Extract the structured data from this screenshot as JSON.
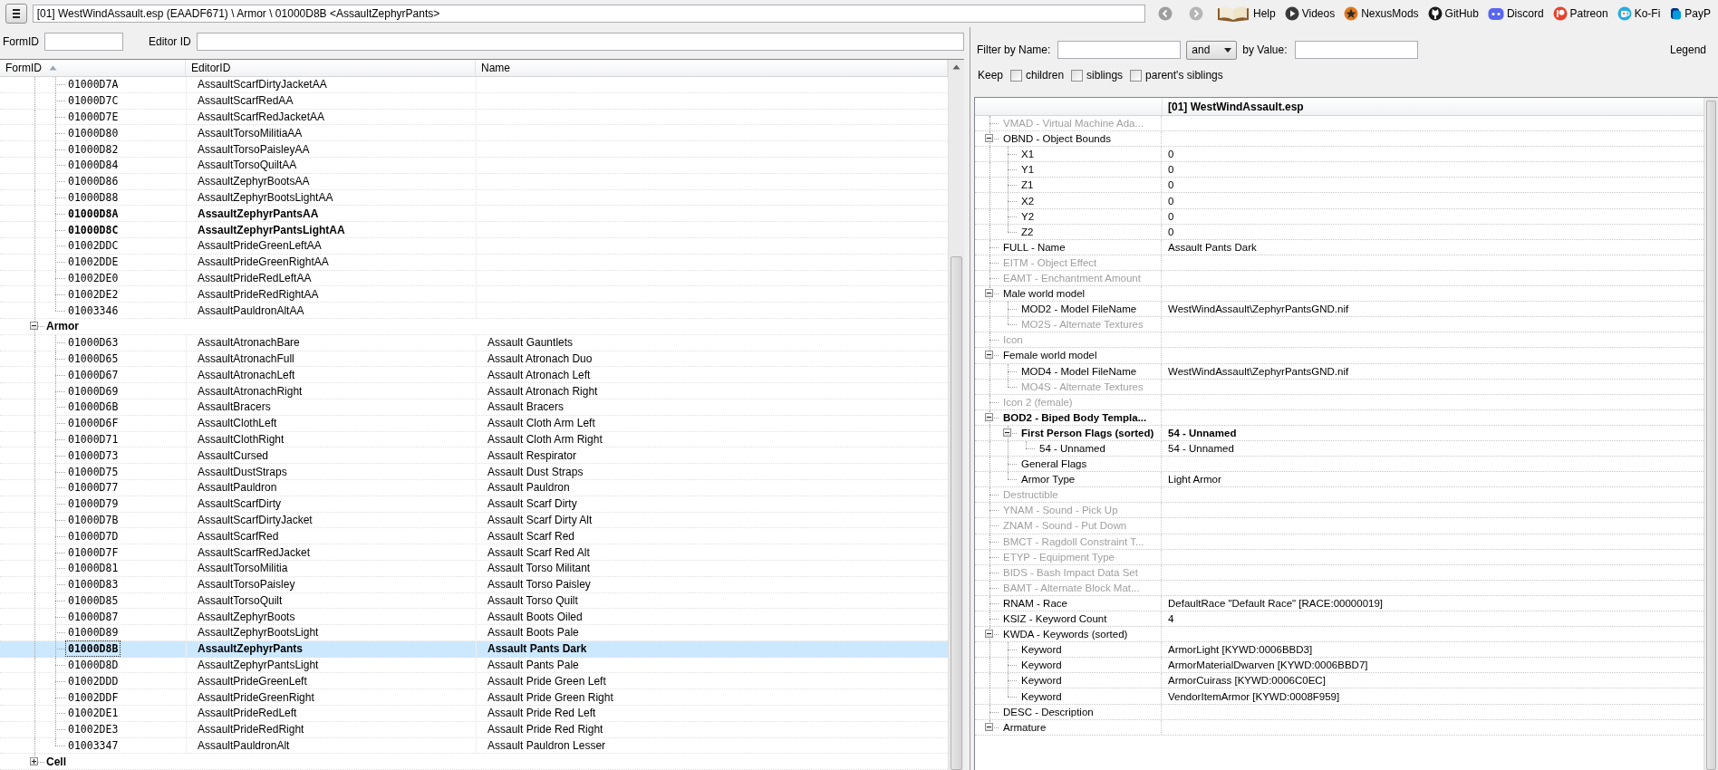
{
  "toolbar": {
    "path": "[01] WestWindAssault.esp (EAADF671) \\ Armor \\ 01000D8B <AssaultZephyrPants>",
    "links": [
      {
        "label": "Help",
        "kind": "book"
      },
      {
        "label": "Videos",
        "kind": "videos"
      },
      {
        "label": "NexusMods",
        "kind": "nexus"
      },
      {
        "label": "GitHub",
        "kind": "github"
      },
      {
        "label": "Discord",
        "kind": "discord"
      },
      {
        "label": "Patreon",
        "kind": "patreon"
      },
      {
        "label": "Ko-Fi",
        "kind": "kofi"
      },
      {
        "label": "PayP",
        "kind": "paypal"
      }
    ]
  },
  "search": {
    "formid_label": "FormID",
    "editorid_label": "Editor ID"
  },
  "records": {
    "columns": [
      {
        "label": "FormID",
        "sorted": true
      },
      {
        "label": "EditorID",
        "sorted": false
      },
      {
        "label": "Name",
        "sorted": false
      }
    ],
    "nodes": [
      {
        "kind": "partial",
        "children": [
          {
            "kind": "record",
            "form_id": "01000D7A",
            "editor_id": "AssaultScarfDirtyJacketAA",
            "bold": false,
            "selected": false
          },
          {
            "kind": "record",
            "form_id": "01000D7C",
            "editor_id": "AssaultScarfRedAA",
            "bold": false,
            "selected": false
          },
          {
            "kind": "record",
            "form_id": "01000D7E",
            "editor_id": "AssaultScarfRedJacketAA",
            "bold": false,
            "selected": false
          },
          {
            "kind": "record",
            "form_id": "01000D80",
            "editor_id": "AssaultTorsoMilitiaAA",
            "bold": false,
            "selected": false
          },
          {
            "kind": "record",
            "form_id": "01000D82",
            "editor_id": "AssaultTorsoPaisleyAA",
            "bold": false,
            "selected": false
          },
          {
            "kind": "record",
            "form_id": "01000D84",
            "editor_id": "AssaultTorsoQuiltAA",
            "bold": false,
            "selected": false
          },
          {
            "kind": "record",
            "form_id": "01000D86",
            "editor_id": "AssaultZephyrBootsAA",
            "bold": false,
            "selected": false
          },
          {
            "kind": "record",
            "form_id": "01000D88",
            "editor_id": "AssaultZephyrBootsLightAA",
            "bold": false,
            "selected": false
          },
          {
            "kind": "record",
            "form_id": "01000D8A",
            "editor_id": "AssaultZephyrPantsAA",
            "bold": true,
            "selected": false
          },
          {
            "kind": "record",
            "form_id": "01000D8C",
            "editor_id": "AssaultZephyrPantsLightAA",
            "bold": true,
            "selected": false
          },
          {
            "kind": "record",
            "form_id": "01002DDC",
            "editor_id": "AssaultPrideGreenLeftAA",
            "bold": false,
            "selected": false
          },
          {
            "kind": "record",
            "form_id": "01002DDE",
            "editor_id": "AssaultPrideGreenRightAA",
            "bold": false,
            "selected": false
          },
          {
            "kind": "record",
            "form_id": "01002DE0",
            "editor_id": "AssaultPrideRedLeftAA",
            "bold": false,
            "selected": false
          },
          {
            "kind": "record",
            "form_id": "01002DE2",
            "editor_id": "AssaultPrideRedRightAA",
            "bold": false,
            "selected": false
          },
          {
            "kind": "record",
            "form_id": "01003346",
            "editor_id": "AssaultPauldronAltAA",
            "bold": false,
            "selected": false
          }
        ]
      },
      {
        "kind": "group",
        "label": "Armor",
        "expanded": true,
        "children": [
          {
            "kind": "record",
            "form_id": "01000D63",
            "editor_id": "AssaultAtronachBare",
            "name": "Assault Gauntlets",
            "bold": false,
            "selected": false
          },
          {
            "kind": "record",
            "form_id": "01000D65",
            "editor_id": "AssaultAtronachFull",
            "name": "Assault Atronach Duo",
            "bold": false,
            "selected": false
          },
          {
            "kind": "record",
            "form_id": "01000D67",
            "editor_id": "AssaultAtronachLeft",
            "name": "Assault Atronach Left",
            "bold": false,
            "selected": false
          },
          {
            "kind": "record",
            "form_id": "01000D69",
            "editor_id": "AssaultAtronachRight",
            "name": "Assault Atronach Right",
            "bold": false,
            "selected": false
          },
          {
            "kind": "record",
            "form_id": "01000D6B",
            "editor_id": "AssaultBracers",
            "name": "Assault Bracers",
            "bold": false,
            "selected": false
          },
          {
            "kind": "record",
            "form_id": "01000D6F",
            "editor_id": "AssaultClothLeft",
            "name": "Assault Cloth Arm Left",
            "bold": false,
            "selected": false
          },
          {
            "kind": "record",
            "form_id": "01000D71",
            "editor_id": "AssaultClothRight",
            "name": "Assault Cloth Arm Right",
            "bold": false,
            "selected": false
          },
          {
            "kind": "record",
            "form_id": "01000D73",
            "editor_id": "AssaultCursed",
            "name": "Assault Respirator",
            "bold": false,
            "selected": false
          },
          {
            "kind": "record",
            "form_id": "01000D75",
            "editor_id": "AssaultDustStraps",
            "name": "Assault Dust Straps",
            "bold": false,
            "selected": false
          },
          {
            "kind": "record",
            "form_id": "01000D77",
            "editor_id": "AssaultPauldron",
            "name": "Assault Pauldron",
            "bold": false,
            "selected": false
          },
          {
            "kind": "record",
            "form_id": "01000D79",
            "editor_id": "AssaultScarfDirty",
            "name": "Assault Scarf Dirty",
            "bold": false,
            "selected": false
          },
          {
            "kind": "record",
            "form_id": "01000D7B",
            "editor_id": "AssaultScarfDirtyJacket",
            "name": "Assault Scarf Dirty Alt",
            "bold": false,
            "selected": false
          },
          {
            "kind": "record",
            "form_id": "01000D7D",
            "editor_id": "AssaultScarfRed",
            "name": "Assault Scarf Red",
            "bold": false,
            "selected": false
          },
          {
            "kind": "record",
            "form_id": "01000D7F",
            "editor_id": "AssaultScarfRedJacket",
            "name": "Assault Scarf Red Alt",
            "bold": false,
            "selected": false
          },
          {
            "kind": "record",
            "form_id": "01000D81",
            "editor_id": "AssaultTorsoMilitia",
            "name": "Assault Torso Militant",
            "bold": false,
            "selected": false
          },
          {
            "kind": "record",
            "form_id": "01000D83",
            "editor_id": "AssaultTorsoPaisley",
            "name": "Assault Torso Paisley",
            "bold": false,
            "selected": false
          },
          {
            "kind": "record",
            "form_id": "01000D85",
            "editor_id": "AssaultTorsoQuilt",
            "name": "Assault Torso Quilt",
            "bold": false,
            "selected": false
          },
          {
            "kind": "record",
            "form_id": "01000D87",
            "editor_id": "AssaultZephyrBoots",
            "name": "Assault Boots Oiled",
            "bold": false,
            "selected": false
          },
          {
            "kind": "record",
            "form_id": "01000D89",
            "editor_id": "AssaultZephyrBootsLight",
            "name": "Assault Boots Pale",
            "bold": false,
            "selected": false
          },
          {
            "kind": "record",
            "form_id": "01000D8B",
            "editor_id": "AssaultZephyrPants",
            "name": "Assault Pants Dark",
            "bold": true,
            "selected": true
          },
          {
            "kind": "record",
            "form_id": "01000D8D",
            "editor_id": "AssaultZephyrPantsLight",
            "name": "Assault Pants Pale",
            "bold": false,
            "selected": false
          },
          {
            "kind": "record",
            "form_id": "01002DDD",
            "editor_id": "AssaultPrideGreenLeft",
            "name": "Assault Pride Green Left",
            "bold": false,
            "selected": false
          },
          {
            "kind": "record",
            "form_id": "01002DDF",
            "editor_id": "AssaultPrideGreenRight",
            "name": "Assault Pride Green Right",
            "bold": false,
            "selected": false
          },
          {
            "kind": "record",
            "form_id": "01002DE1",
            "editor_id": "AssaultPrideRedLeft",
            "name": "Assault Pride Red Left",
            "bold": false,
            "selected": false
          },
          {
            "kind": "record",
            "form_id": "01002DE3",
            "editor_id": "AssaultPrideRedRight",
            "name": "Assault Pride Red Right",
            "bold": false,
            "selected": false
          },
          {
            "kind": "record",
            "form_id": "01003347",
            "editor_id": "AssaultPauldronAlt",
            "name": "Assault Pauldron Lesser",
            "bold": false,
            "selected": false
          }
        ]
      },
      {
        "kind": "group",
        "label": "Cell",
        "expanded": false
      }
    ]
  },
  "filter": {
    "name_label": "Filter by Name:",
    "operator": "and",
    "value_label": "by Value:",
    "legend": "Legend",
    "keep_label": "Keep",
    "keep_options": [
      {
        "label": "children",
        "checked": false
      },
      {
        "label": "siblings",
        "checked": false
      },
      {
        "label": "parent's siblings",
        "checked": false
      }
    ]
  },
  "record": {
    "header": "[01] WestWindAssault.esp",
    "elements": [
      {
        "label": "VMAD - Virtual Machine Ada...",
        "greyed": true,
        "bold": false
      },
      {
        "label": "OBND - Object Bounds",
        "greyed": false,
        "bold": false,
        "expanded": true,
        "children": [
          {
            "label": "X1",
            "value": "0",
            "greyed": false,
            "bold": false
          },
          {
            "label": "Y1",
            "value": "0",
            "greyed": false,
            "bold": false
          },
          {
            "label": "Z1",
            "value": "0",
            "greyed": false,
            "bold": false
          },
          {
            "label": "X2",
            "value": "0",
            "greyed": false,
            "bold": false
          },
          {
            "label": "Y2",
            "value": "0",
            "greyed": false,
            "bold": false
          },
          {
            "label": "Z2",
            "value": "0",
            "greyed": false,
            "bold": false
          }
        ]
      },
      {
        "label": "FULL - Name",
        "value": "Assault Pants Dark",
        "greyed": false,
        "bold": false
      },
      {
        "label": "EITM - Object Effect",
        "greyed": true,
        "bold": false
      },
      {
        "label": "EAMT - Enchantment Amount",
        "greyed": true,
        "bold": false
      },
      {
        "label": "Male world model",
        "greyed": false,
        "bold": false,
        "expanded": true,
        "children": [
          {
            "label": "MOD2 - Model FileName",
            "value": "WestWindAssault\\ZephyrPantsGND.nif",
            "greyed": false,
            "bold": false
          },
          {
            "label": "MO2S - Alternate Textures",
            "greyed": true,
            "bold": false
          }
        ]
      },
      {
        "label": "Icon",
        "greyed": true,
        "bold": false
      },
      {
        "label": "Female world model",
        "greyed": false,
        "bold": false,
        "expanded": true,
        "children": [
          {
            "label": "MOD4 - Model FileName",
            "value": "WestWindAssault\\ZephyrPantsGND.nif",
            "greyed": false,
            "bold": false
          },
          {
            "label": "MO4S - Alternate Textures",
            "greyed": true,
            "bold": false
          }
        ]
      },
      {
        "label": "Icon 2 (female)",
        "greyed": true,
        "bold": false
      },
      {
        "label": "BOD2 - Biped Body Templa...",
        "greyed": false,
        "bold": true,
        "expanded": true,
        "children": [
          {
            "label": "First Person Flags (sorted)",
            "value": "54 - Unnamed",
            "greyed": false,
            "bold": true,
            "expanded": true,
            "children": [
              {
                "label": "54 - Unnamed",
                "value": "54 - Unnamed",
                "greyed": false,
                "bold": false
              }
            ]
          },
          {
            "label": "General Flags",
            "greyed": false,
            "bold": false
          },
          {
            "label": "Armor Type",
            "value": "Light Armor",
            "greyed": false,
            "bold": false
          }
        ]
      },
      {
        "label": "Destructible",
        "greyed": true,
        "bold": false
      },
      {
        "label": "YNAM - Sound - Pick Up",
        "greyed": true,
        "bold": false
      },
      {
        "label": "ZNAM - Sound - Put Down",
        "greyed": true,
        "bold": false
      },
      {
        "label": "BMCT - Ragdoll Constraint T...",
        "greyed": true,
        "bold": false
      },
      {
        "label": "ETYP - Equipment Type",
        "greyed": true,
        "bold": false
      },
      {
        "label": "BIDS - Bash Impact Data Set",
        "greyed": true,
        "bold": false
      },
      {
        "label": "BAMT - Alternate Block Mat...",
        "greyed": true,
        "bold": false
      },
      {
        "label": "RNAM - Race",
        "value": "DefaultRace \"Default Race\" [RACE:00000019]",
        "greyed": false,
        "bold": false
      },
      {
        "label": "KSIZ - Keyword Count",
        "value": "4",
        "greyed": false,
        "bold": false
      },
      {
        "label": "KWDA - Keywords (sorted)",
        "greyed": false,
        "bold": false,
        "expanded": true,
        "children": [
          {
            "label": "Keyword",
            "value": "ArmorLight [KYWD:0006BBD3]",
            "greyed": false,
            "bold": false
          },
          {
            "label": "Keyword",
            "value": "ArmorMaterialDwarven [KYWD:0006BBD7]",
            "greyed": false,
            "bold": false
          },
          {
            "label": "Keyword",
            "value": "ArmorCuirass [KYWD:0006C0EC]",
            "greyed": false,
            "bold": false
          },
          {
            "label": "Keyword",
            "value": "VendorItemArmor [KYWD:0008F959]",
            "greyed": false,
            "bold": false
          }
        ]
      },
      {
        "label": "DESC - Description",
        "greyed": false,
        "bold": false
      },
      {
        "label": "Armature",
        "greyed": false,
        "bold": false,
        "expanded": true
      }
    ]
  }
}
